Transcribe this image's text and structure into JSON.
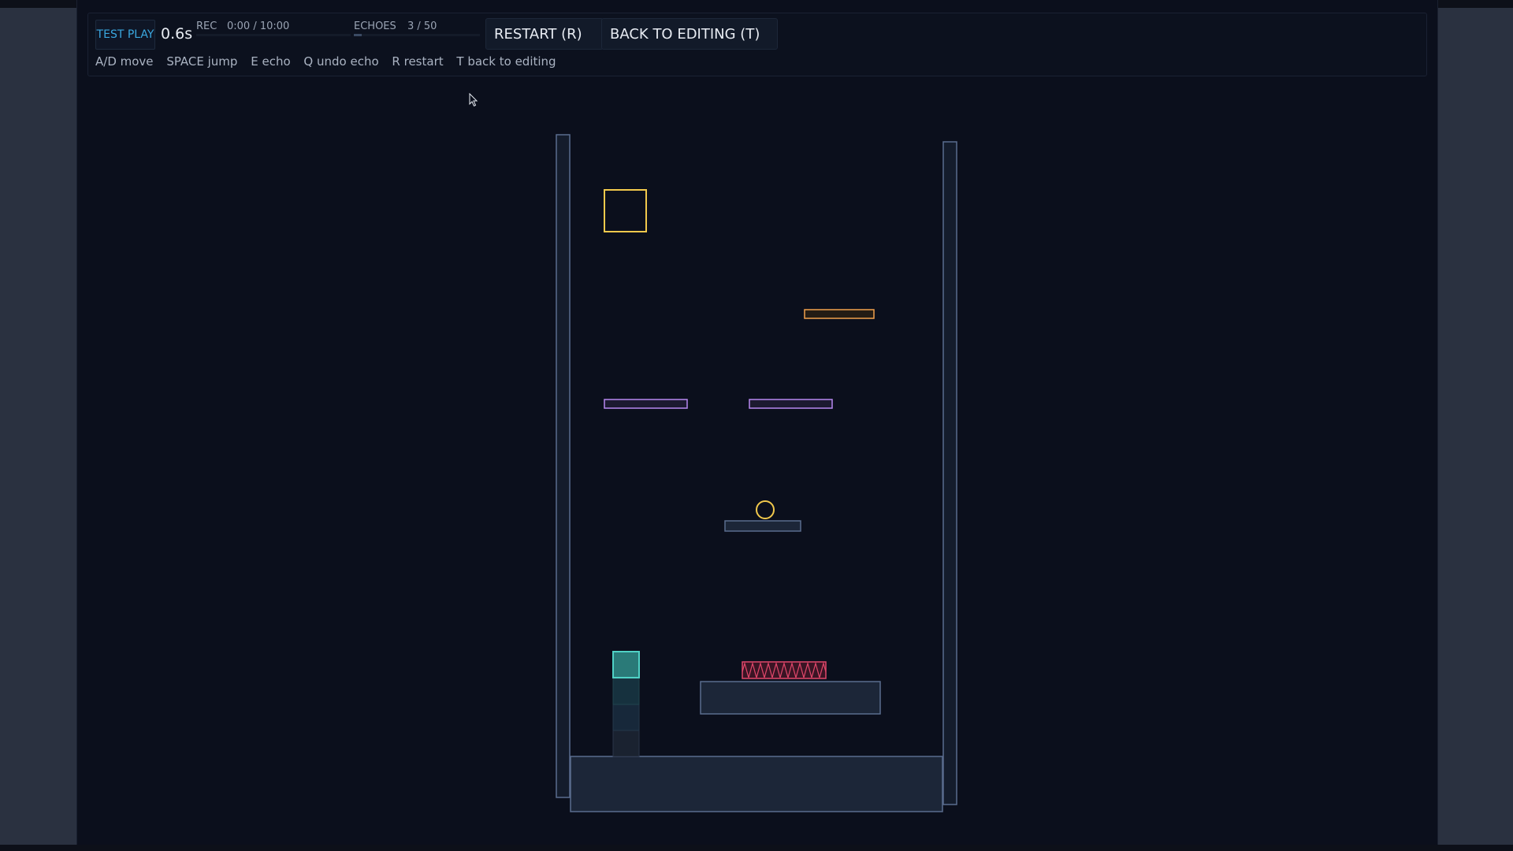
{
  "hud": {
    "mode": "TEST PLAY",
    "time": "0.6s",
    "rec_label": "REC",
    "rec_time": "0:00 / 10:00",
    "rec_progress": 0.0,
    "echoes_label": "ECHOES",
    "echoes_count": "3 / 50",
    "echoes_progress": 0.06,
    "restart_label": "RESTART  (R)",
    "back_label": "BACK TO EDITING  (T)",
    "hints": [
      "A/D move",
      "SPACE jump",
      "E echo",
      "Q undo echo",
      "R restart",
      "T back to editing"
    ]
  },
  "colors": {
    "accent": "#3aa8e0",
    "wall_stroke": "#5a6d8e",
    "wall_fill": "#1c2638",
    "goal": "#f2c94c",
    "coin": "#f2c94c",
    "moving_platform": "#f2a14c",
    "one_way_platform": "#b788f0",
    "hazard": "#e0466a",
    "player": "#4fd1c5"
  },
  "icons": {
    "cursor": "mouse-pointer-icon"
  }
}
